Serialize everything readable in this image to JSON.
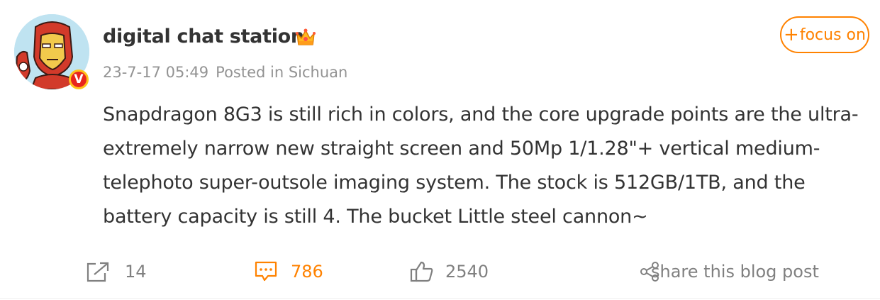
{
  "post": {
    "author": {
      "name": "digital chat station",
      "verified_badge": "V"
    },
    "timestamp": "23-7-17 05:49",
    "location": "Posted in Sichuan",
    "follow_label": "focus on",
    "text": "Snapdragon 8G3 is still rich in colors, and the core upgrade points are the ultra-extremely narrow new straight screen and 50Mp 1/1.28\"+ vertical medium-telephoto super-outsole imaging system. The stock is 512GB/1TB, and the battery capacity is still 4. The bucket Little steel cannon~"
  },
  "actions": {
    "repost_count": "14",
    "comment_count": "786",
    "like_count": "2540",
    "share_label": "share this blog post"
  },
  "colors": {
    "accent": "#ff8200",
    "text": "#333333",
    "meta": "#939393",
    "icon": "#808080",
    "verified_red": "#e8251c",
    "verified_ring": "#ffc21a"
  },
  "icons": {
    "avatar": "iron-man-avatar",
    "crown": "crown-icon",
    "repost": "repost-icon",
    "comment": "comment-icon",
    "like": "thumbs-up-icon",
    "share": "share-icon"
  }
}
